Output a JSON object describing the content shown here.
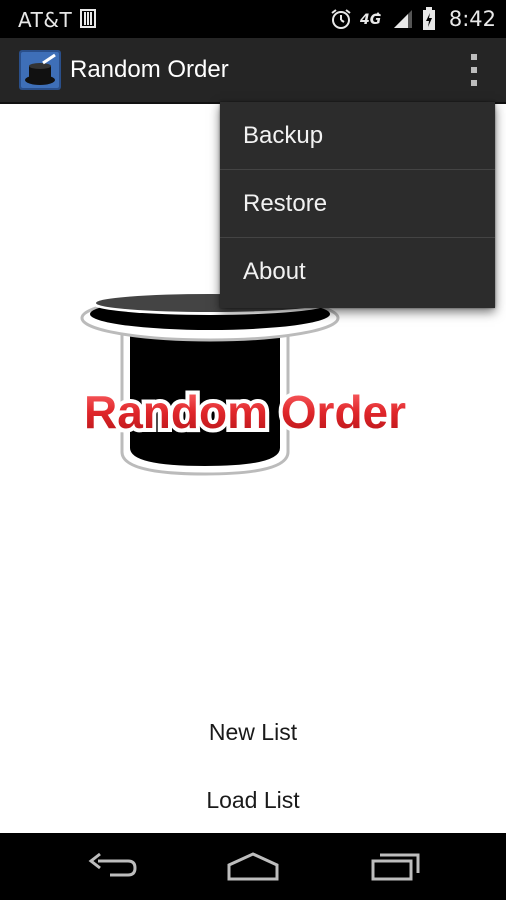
{
  "status_bar": {
    "carrier": "AT&T",
    "time": "8:42",
    "icons": [
      "sim-card-icon",
      "alarm-icon",
      "network-4g-icon",
      "signal-icon",
      "battery-icon"
    ]
  },
  "action_bar": {
    "title": "Random Order",
    "app_icon": "top-hat-icon",
    "overflow_icon": "overflow-menu-icon"
  },
  "overflow_menu": {
    "items": [
      {
        "label": "Backup"
      },
      {
        "label": "Restore"
      },
      {
        "label": "About"
      }
    ]
  },
  "logo": {
    "text": "Random Order",
    "text_color": "#e0262a"
  },
  "buttons": {
    "new_list": "New List",
    "load_list": "Load List"
  },
  "nav_bar": {
    "icons": [
      "back-icon",
      "home-icon",
      "recent-apps-icon"
    ]
  },
  "colors": {
    "action_bar_bg": "#252525",
    "menu_bg": "#2c2c2c",
    "status_bar_bg": "#000000"
  }
}
